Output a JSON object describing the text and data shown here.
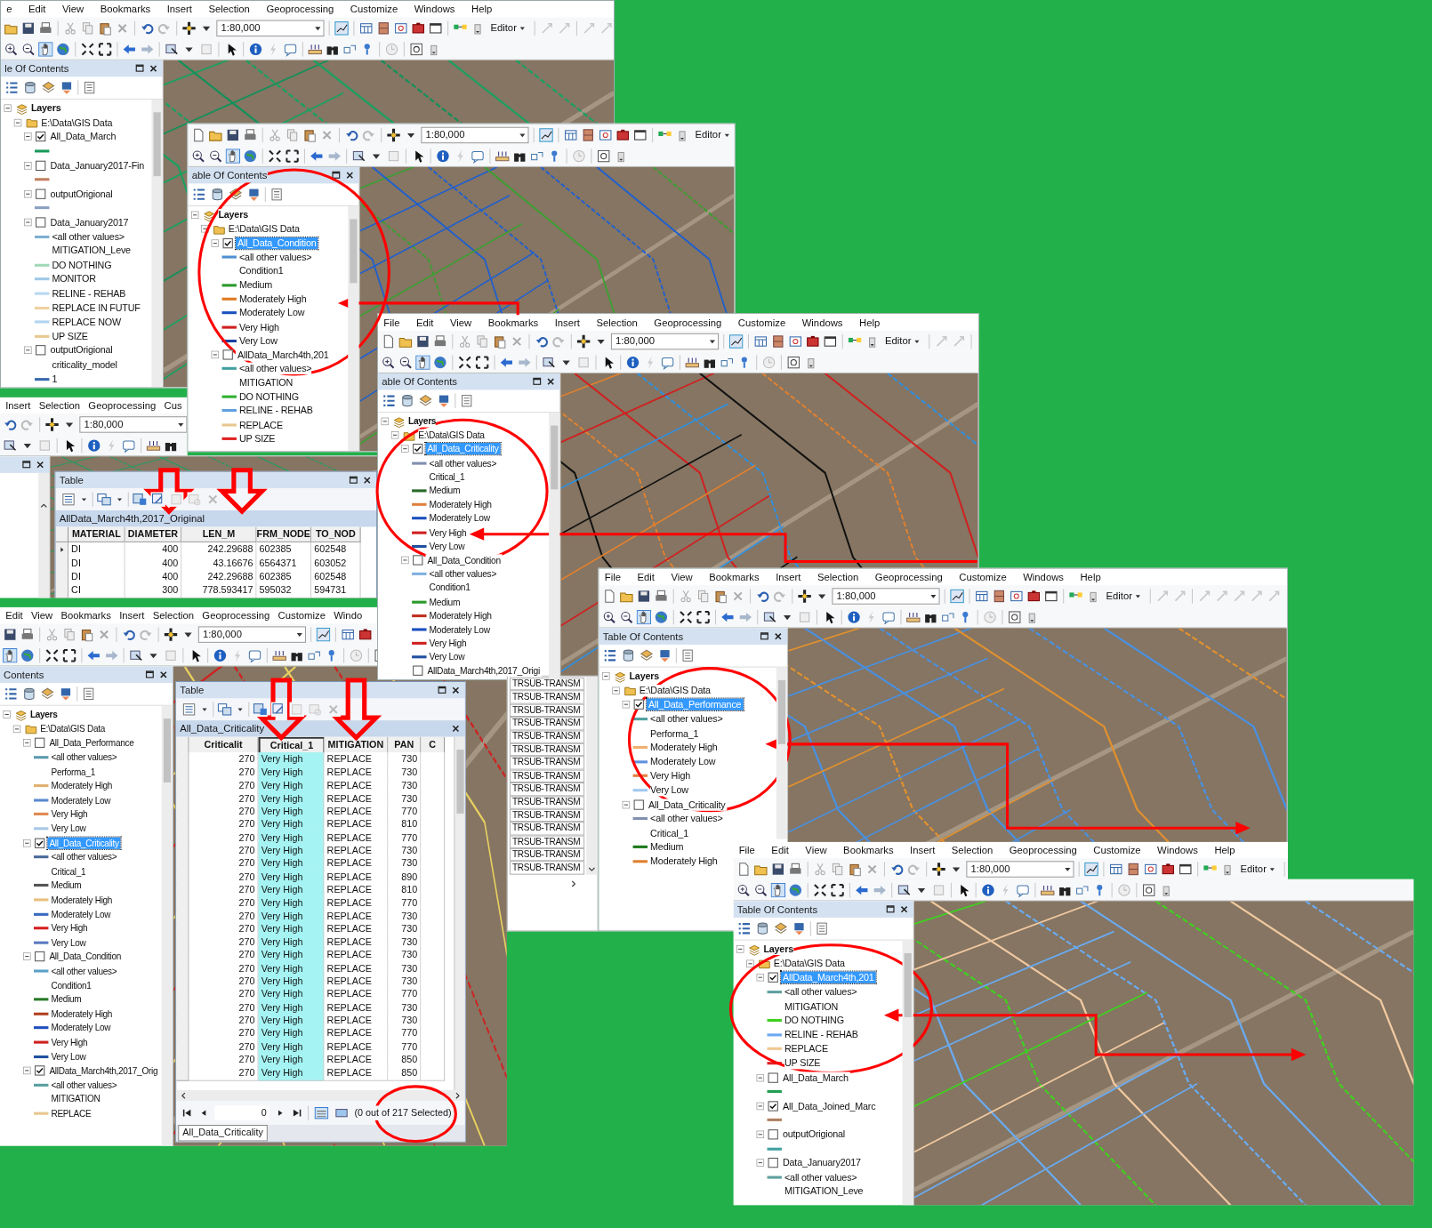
{
  "windows": [
    {
      "menu": [
        "e",
        "Edit",
        "View",
        "Bookmarks",
        "Insert",
        "Selection",
        "Geoprocessing",
        "Customize",
        "Windows",
        "Help"
      ],
      "scale": "1:80,000",
      "editor": "Editor",
      "toc": {
        "title": "le Of Contents",
        "tree": [
          {
            "kind": "group",
            "label": "Layers",
            "children": [
              {
                "kind": "folder",
                "label": "E:\\Data\\GIS Data",
                "children": [
                  {
                    "kind": "layer",
                    "label": "All_Data_March",
                    "checked": true,
                    "selected": false,
                    "children": [
                      {
                        "kind": "legend",
                        "color": "#1a9a5a"
                      }
                    ]
                  },
                  {
                    "kind": "layer",
                    "label": "Data_January2017-Fin",
                    "checked": false,
                    "selected": false,
                    "children": [
                      {
                        "kind": "legend",
                        "color": "#c08060"
                      }
                    ]
                  },
                  {
                    "kind": "layer",
                    "label": "outputOrigional",
                    "checked": false,
                    "selected": false,
                    "children": [
                      {
                        "kind": "legend",
                        "color": "#8aa0c0"
                      }
                    ]
                  },
                  {
                    "kind": "layer",
                    "label": "Data_January2017",
                    "checked": false,
                    "selected": false,
                    "children": [
                      {
                        "kind": "legend",
                        "label": "<all other values>",
                        "color": "#7fb0d0"
                      },
                      {
                        "kind": "field",
                        "label": "MITIGATION_Leve"
                      },
                      {
                        "kind": "legend",
                        "label": "DO NOTHING",
                        "color": "#9fd8b8"
                      },
                      {
                        "kind": "legend",
                        "label": "MONITOR",
                        "color": "#9fc8e8"
                      },
                      {
                        "kind": "legend",
                        "label": "RELINE - REHAB",
                        "color": "#b8d8f0"
                      },
                      {
                        "kind": "legend",
                        "label": "REPLACE IN FUTUF",
                        "color": "#f0d0a0"
                      },
                      {
                        "kind": "legend",
                        "label": "REPLACE NOW",
                        "color": "#b0d4f0"
                      },
                      {
                        "kind": "legend",
                        "label": "UP SIZE",
                        "color": "#e8c890"
                      }
                    ]
                  },
                  {
                    "kind": "layer",
                    "label": "outputOrigional",
                    "checked": false,
                    "selected": false,
                    "children": [
                      {
                        "kind": "field",
                        "label": "criticality_model"
                      },
                      {
                        "kind": "legend",
                        "label": "1",
                        "color": "#3a6ab0"
                      }
                    ]
                  }
                ]
              }
            ]
          }
        ]
      }
    },
    {
      "menu": [
        "Insert",
        "Selection",
        "Geoprocessing",
        "Cus"
      ],
      "scale": "1:80,000",
      "table": {
        "title": "Table",
        "layer_tab": "AllData_March4th,2017_Original",
        "columns": [
          {
            "label": "MATERIAL",
            "selected": false
          },
          {
            "label": "DIAMETER",
            "selected": false
          },
          {
            "label": "LEN_M",
            "selected": false
          },
          {
            "label": "FRM_NODE",
            "selected": false
          },
          {
            "label": "TO_NOD",
            "selected": false
          }
        ],
        "rows": [
          {
            "current": true,
            "cells": [
              "DI",
              "400",
              "242.29688",
              "602385",
              "602548"
            ]
          },
          {
            "current": false,
            "cells": [
              "DI",
              "400",
              "43.16676",
              "6564371",
              "603052"
            ]
          },
          {
            "current": false,
            "cells": [
              "DI",
              "400",
              "242.29688",
              "602385",
              "602548"
            ]
          },
          {
            "current": false,
            "cells": [
              "CI",
              "300",
              "778.593417",
              "595032",
              "594731"
            ]
          }
        ]
      }
    },
    {
      "scale": "1:80,000",
      "editor": "Editor",
      "toc": {
        "title": "able Of Contents",
        "tree": [
          {
            "kind": "group",
            "label": "Layers",
            "children": [
              {
                "kind": "folder",
                "label": "E:\\Data\\GIS Data",
                "children": [
                  {
                    "kind": "layer",
                    "label": "All_Data_Condition",
                    "checked": true,
                    "selected": true,
                    "children": [
                      {
                        "kind": "legend",
                        "label": "<all other values>",
                        "color": "#5090d0"
                      },
                      {
                        "kind": "field",
                        "label": "Condition1"
                      },
                      {
                        "kind": "legend",
                        "label": "Medium",
                        "color": "#2a9a2a"
                      },
                      {
                        "kind": "legend",
                        "label": "Moderately High",
                        "color": "#e07a20"
                      },
                      {
                        "kind": "legend",
                        "label": "Moderately Low",
                        "color": "#1a50c0"
                      },
                      {
                        "kind": "legend",
                        "label": "Very High",
                        "color": "#d02020"
                      },
                      {
                        "kind": "legend",
                        "label": "Very Low",
                        "color": "#1a40a0"
                      }
                    ]
                  },
                  {
                    "kind": "layer",
                    "label": "AllData_March4th,201",
                    "checked": false,
                    "selected": false,
                    "children": [
                      {
                        "kind": "legend",
                        "label": "<all other values>",
                        "color": "#40a0a0"
                      },
                      {
                        "kind": "field",
                        "label": "MITIGATION"
                      },
                      {
                        "kind": "legend",
                        "label": "DO NOTHING",
                        "color": "#30b030"
                      },
                      {
                        "kind": "legend",
                        "label": "RELINE - REHAB",
                        "color": "#60a0e0"
                      },
                      {
                        "kind": "legend",
                        "label": "REPLACE",
                        "color": "#e8c890"
                      },
                      {
                        "kind": "legend",
                        "label": "UP SIZE",
                        "color": "#e02020"
                      }
                    ]
                  }
                ]
              }
            ]
          }
        ]
      }
    },
    {
      "menu": [
        "Edit",
        "View",
        "Bookmarks",
        "Insert",
        "Selection",
        "Geoprocessing",
        "Customize",
        "Windo"
      ],
      "scale": "1:80,000",
      "toc": {
        "title": "Contents",
        "tree": [
          {
            "kind": "group",
            "label": "Layers",
            "children": [
              {
                "kind": "folder",
                "label": "E:\\Data\\GIS Data",
                "children": [
                  {
                    "kind": "layer",
                    "label": "All_Data_Performance",
                    "checked": false,
                    "selected": false,
                    "children": [
                      {
                        "kind": "legend",
                        "label": "<all other values>",
                        "color": "#5a9ab0"
                      },
                      {
                        "kind": "field",
                        "label": "Performa_1"
                      },
                      {
                        "kind": "legend",
                        "label": "Moderately High",
                        "color": "#e0b070"
                      },
                      {
                        "kind": "legend",
                        "label": "Moderately Low",
                        "color": "#5a8ad0"
                      },
                      {
                        "kind": "legend",
                        "label": "Very High",
                        "color": "#e08a50"
                      },
                      {
                        "kind": "legend",
                        "label": "Very Low",
                        "color": "#a8c8e8"
                      }
                    ]
                  },
                  {
                    "kind": "layer",
                    "label": "All_Data_Criticality",
                    "checked": true,
                    "selected": true,
                    "children": [
                      {
                        "kind": "legend",
                        "label": "<all other values>",
                        "color": "#4a6a9a"
                      },
                      {
                        "kind": "field",
                        "label": "Critical_1"
                      },
                      {
                        "kind": "legend",
                        "label": "Medium",
                        "color": "#555555"
                      },
                      {
                        "kind": "legend",
                        "label": "Moderately High",
                        "color": "#e8c080"
                      },
                      {
                        "kind": "legend",
                        "label": "Moderately Low",
                        "color": "#3a6ac0"
                      },
                      {
                        "kind": "legend",
                        "label": "Very High",
                        "color": "#d82020"
                      },
                      {
                        "kind": "legend",
                        "label": "Very Low",
                        "color": "#5a7ac0"
                      }
                    ]
                  },
                  {
                    "kind": "layer",
                    "label": "All_Data_Condition",
                    "checked": false,
                    "selected": false,
                    "children": [
                      {
                        "kind": "legend",
                        "label": "<all other values>",
                        "color": "#5aa0c8"
                      },
                      {
                        "kind": "field",
                        "label": "Condition1"
                      },
                      {
                        "kind": "legend",
                        "label": "Medium",
                        "color": "#2a7a2a"
                      },
                      {
                        "kind": "legend",
                        "label": "Moderately High",
                        "color": "#b04020"
                      },
                      {
                        "kind": "legend",
                        "label": "Moderately Low",
                        "color": "#2050c0"
                      },
                      {
                        "kind": "legend",
                        "label": "Very High",
                        "color": "#d02020"
                      },
                      {
                        "kind": "legend",
                        "label": "Very Low",
                        "color": "#2050a0"
                      }
                    ]
                  },
                  {
                    "kind": "layer",
                    "label": "AllData_March4th,2017_Orig",
                    "checked": true,
                    "selected": false,
                    "children": [
                      {
                        "kind": "legend",
                        "label": "<all other values>",
                        "color": "#5aa0a0"
                      },
                      {
                        "kind": "field",
                        "label": "MITIGATION"
                      },
                      {
                        "kind": "legend",
                        "label": "REPLACE",
                        "color": "#e8c890"
                      }
                    ]
                  }
                ]
              }
            ]
          }
        ]
      },
      "table": {
        "title": "Table",
        "layer_tab": "All_Data_Criticality",
        "columns": [
          {
            "label": "Criticalit",
            "selected": false
          },
          {
            "label": "Critical_1",
            "selected": true
          },
          {
            "label": "MITIGATION",
            "selected": false
          },
          {
            "label": "PAN",
            "selected": false
          },
          {
            "label": "C",
            "selected": false
          }
        ],
        "rows": [
          {
            "current": false,
            "cells": [
              "270",
              "Very High",
              "REPLACE",
              "730",
              ""
            ]
          },
          {
            "current": false,
            "cells": [
              "270",
              "Very High",
              "REPLACE",
              "730",
              ""
            ]
          },
          {
            "current": false,
            "cells": [
              "270",
              "Very High",
              "REPLACE",
              "730",
              ""
            ]
          },
          {
            "current": false,
            "cells": [
              "270",
              "Very High",
              "REPLACE",
              "730",
              ""
            ]
          },
          {
            "current": false,
            "cells": [
              "270",
              "Very High",
              "REPLACE",
              "770",
              ""
            ]
          },
          {
            "current": false,
            "cells": [
              "270",
              "Very High",
              "REPLACE",
              "810",
              ""
            ]
          },
          {
            "current": false,
            "cells": [
              "270",
              "Very High",
              "REPLACE",
              "770",
              ""
            ]
          },
          {
            "current": false,
            "cells": [
              "270",
              "Very High",
              "REPLACE",
              "730",
              ""
            ]
          },
          {
            "current": false,
            "cells": [
              "270",
              "Very High",
              "REPLACE",
              "730",
              ""
            ]
          },
          {
            "current": false,
            "cells": [
              "270",
              "Very High",
              "REPLACE",
              "890",
              ""
            ]
          },
          {
            "current": false,
            "cells": [
              "270",
              "Very High",
              "REPLACE",
              "810",
              ""
            ]
          },
          {
            "current": false,
            "cells": [
              "270",
              "Very High",
              "REPLACE",
              "770",
              ""
            ]
          },
          {
            "current": false,
            "cells": [
              "270",
              "Very High",
              "REPLACE",
              "730",
              ""
            ]
          },
          {
            "current": false,
            "cells": [
              "270",
              "Very High",
              "REPLACE",
              "730",
              ""
            ]
          },
          {
            "current": false,
            "cells": [
              "270",
              "Very High",
              "REPLACE",
              "730",
              ""
            ]
          },
          {
            "current": false,
            "cells": [
              "270",
              "Very High",
              "REPLACE",
              "730",
              ""
            ]
          },
          {
            "current": false,
            "cells": [
              "270",
              "Very High",
              "REPLACE",
              "730",
              ""
            ]
          },
          {
            "current": false,
            "cells": [
              "270",
              "Very High",
              "REPLACE",
              "730",
              ""
            ]
          },
          {
            "current": false,
            "cells": [
              "270",
              "Very High",
              "REPLACE",
              "770",
              ""
            ]
          },
          {
            "current": false,
            "cells": [
              "270",
              "Very High",
              "REPLACE",
              "730",
              ""
            ]
          },
          {
            "current": false,
            "cells": [
              "270",
              "Very High",
              "REPLACE",
              "730",
              ""
            ]
          },
          {
            "current": false,
            "cells": [
              "270",
              "Very High",
              "REPLACE",
              "770",
              ""
            ]
          },
          {
            "current": false,
            "cells": [
              "270",
              "Very High",
              "REPLACE",
              "770",
              ""
            ]
          },
          {
            "current": false,
            "cells": [
              "270",
              "Very High",
              "REPLACE",
              "850",
              ""
            ]
          },
          {
            "current": false,
            "cells": [
              "270",
              "Very High",
              "REPLACE",
              "850",
              ""
            ]
          }
        ],
        "record": "0",
        "selection_count": "(0 out of 217 Selected)",
        "bottom_tab": "All_Data_Criticality"
      }
    },
    {
      "menu": [
        "File",
        "Edit",
        "View",
        "Bookmarks",
        "Insert",
        "Selection",
        "Geoprocessing",
        "Customize",
        "Windows",
        "Help"
      ],
      "scale": "1:80,000",
      "editor": "Editor",
      "toc": {
        "title": "able Of Contents",
        "tree": [
          {
            "kind": "group",
            "label": "Layers",
            "children": [
              {
                "kind": "folder",
                "label": "E:\\Data\\GIS Data",
                "children": [
                  {
                    "kind": "layer",
                    "label": "All_Data_Criticality",
                    "checked": true,
                    "selected": true,
                    "children": [
                      {
                        "kind": "legend",
                        "label": "<all other values>",
                        "color": "#8090b0"
                      },
                      {
                        "kind": "field",
                        "label": "Critical_1"
                      },
                      {
                        "kind": "legend",
                        "label": "Medium",
                        "color": "#2a6a2a"
                      },
                      {
                        "kind": "legend",
                        "label": "Moderately High",
                        "color": "#e08040"
                      },
                      {
                        "kind": "legend",
                        "label": "Moderately Low",
                        "color": "#1a50c0"
                      },
                      {
                        "kind": "legend",
                        "label": "Very High",
                        "color": "#d02020"
                      },
                      {
                        "kind": "legend",
                        "label": "Very Low",
                        "color": "#2050a0"
                      }
                    ]
                  },
                  {
                    "kind": "layer",
                    "label": "All_Data_Condition",
                    "checked": false,
                    "selected": false,
                    "children": [
                      {
                        "kind": "legend",
                        "label": "<all other values>",
                        "color": "#80b0e0"
                      },
                      {
                        "kind": "field",
                        "label": "Condition1"
                      },
                      {
                        "kind": "legend",
                        "label": "Medium",
                        "color": "#2a9a2a"
                      },
                      {
                        "kind": "legend",
                        "label": "Moderately High",
                        "color": "#c03020"
                      },
                      {
                        "kind": "legend",
                        "label": "Moderately Low",
                        "color": "#1a50c0"
                      },
                      {
                        "kind": "legend",
                        "label": "Very High",
                        "color": "#d02020"
                      },
                      {
                        "kind": "legend",
                        "label": "Very Low",
                        "color": "#2050a0"
                      }
                    ]
                  },
                  {
                    "kind": "layer",
                    "label": "AllData_March4th,2017_Origi",
                    "checked": false,
                    "selected": false
                  }
                ]
              }
            ]
          }
        ]
      }
    },
    {
      "menu": [
        "File",
        "Edit",
        "View",
        "Bookmarks",
        "Insert",
        "Selection",
        "Geoprocessing",
        "Customize",
        "Windows",
        "Help"
      ],
      "scale": "1:80,000",
      "editor": "Editor",
      "toc": {
        "title": "Table Of Contents",
        "tree": [
          {
            "kind": "group",
            "label": "Layers",
            "children": [
              {
                "kind": "folder",
                "label": "E:\\Data\\GIS Data",
                "children": [
                  {
                    "kind": "layer",
                    "label": "All_Data_Performance",
                    "checked": true,
                    "selected": true,
                    "children": [
                      {
                        "kind": "legend",
                        "label": "<all other values>",
                        "color": "#50a0a0"
                      },
                      {
                        "kind": "field",
                        "label": "Performa_1"
                      },
                      {
                        "kind": "legend",
                        "label": "Moderately High",
                        "color": "#f0b070"
                      },
                      {
                        "kind": "legend",
                        "label": "Moderately Low",
                        "color": "#6090e0"
                      },
                      {
                        "kind": "legend",
                        "label": "Very High",
                        "color": "#e08040"
                      },
                      {
                        "kind": "legend",
                        "label": "Very Low",
                        "color": "#a0c8f0"
                      }
                    ]
                  },
                  {
                    "kind": "layer",
                    "label": "All_Data_Criticality",
                    "checked": false,
                    "selected": false,
                    "children": [
                      {
                        "kind": "legend",
                        "label": "<all other values>",
                        "color": "#8090b0"
                      },
                      {
                        "kind": "field",
                        "label": "Critical_1"
                      },
                      {
                        "kind": "legend",
                        "label": "Medium",
                        "color": "#1a7a1a"
                      },
                      {
                        "kind": "legend",
                        "label": "Moderately High",
                        "color": "#e08030"
                      }
                    ]
                  }
                ]
              }
            ]
          }
        ]
      }
    },
    {
      "menu": [
        "File",
        "Edit",
        "View",
        "Bookmarks",
        "Insert",
        "Selection",
        "Geoprocessing",
        "Customize",
        "Windows",
        "Help"
      ],
      "scale": "1:80,000",
      "editor": "Editor",
      "toc": {
        "title": "Table Of Contents",
        "tree": [
          {
            "kind": "group",
            "label": "Layers",
            "children": [
              {
                "kind": "folder",
                "label": "E:\\Data\\GIS Data",
                "children": [
                  {
                    "kind": "layer",
                    "label": "AllData_March4th,201",
                    "checked": true,
                    "selected": true,
                    "children": [
                      {
                        "kind": "legend",
                        "label": "<all other values>",
                        "color": "#60a0a0"
                      },
                      {
                        "kind": "field",
                        "label": "MITIGATION"
                      },
                      {
                        "kind": "legend",
                        "label": "DO NOTHING",
                        "color": "#40d020"
                      },
                      {
                        "kind": "legend",
                        "label": "RELINE - REHAB",
                        "color": "#6aaaf0"
                      },
                      {
                        "kind": "legend",
                        "label": "REPLACE",
                        "color": "#f0c890"
                      },
                      {
                        "kind": "legend",
                        "label": "UP SIZE",
                        "color": "#e02020"
                      }
                    ]
                  },
                  {
                    "kind": "layer",
                    "label": "All_Data_March",
                    "checked": false,
                    "selected": false,
                    "children": [
                      {
                        "kind": "legend",
                        "color": "#20a050"
                      }
                    ]
                  },
                  {
                    "kind": "layer",
                    "label": "All_Data_Joined_Marc",
                    "checked": true,
                    "selected": false,
                    "children": [
                      {
                        "kind": "legend",
                        "color": "#b08060"
                      }
                    ]
                  },
                  {
                    "kind": "layer",
                    "label": "outputOrigional",
                    "checked": false,
                    "selected": false,
                    "children": [
                      {
                        "kind": "legend",
                        "color": "#40a0a0"
                      }
                    ]
                  },
                  {
                    "kind": "layer",
                    "label": "Data_January2017",
                    "checked": false,
                    "selected": false,
                    "children": [
                      {
                        "kind": "legend",
                        "label": "<all other values>",
                        "color": "#60a0a0"
                      },
                      {
                        "kind": "field",
                        "label": "MITIGATION_Leve"
                      }
                    ]
                  }
                ]
              }
            ]
          }
        ]
      }
    }
  ],
  "column_fragment": {
    "cells": [
      "TRSUB-TRANSM",
      "TRSUB-TRANSM",
      "TRSUB-TRANSM",
      "TRSUB-TRANSM",
      "TRSUB-TRANSM",
      "TRSUB-TRANSM",
      "TRSUB-TRANSM",
      "TRSUB-TRANSM",
      "TRSUB-TRANSM",
      "TRSUB-TRANSM",
      "TRSUB-TRANSM",
      "TRSUB-TRANSM",
      "TRSUB-TRANSM",
      "TRSUB-TRANSM",
      "TRSUB-TRANSM"
    ]
  }
}
